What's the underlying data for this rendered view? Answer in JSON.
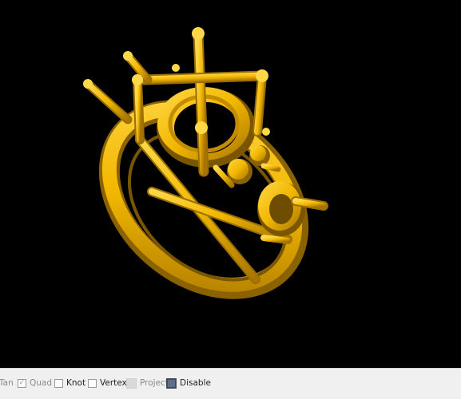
{
  "viewport": {
    "background": "#000000",
    "model_color": "#f2b800",
    "model_shadow": "#8a6200"
  },
  "status_bar": {
    "snaps": [
      {
        "label": "Tan",
        "checked": false,
        "enabled": false
      },
      {
        "label": "Quad",
        "checked": true,
        "enabled": false
      },
      {
        "label": "Knot",
        "checked": false,
        "enabled": true
      },
      {
        "label": "Vertex",
        "checked": false,
        "enabled": true
      },
      {
        "label": "Project",
        "checked": false,
        "enabled": false
      },
      {
        "label": "Disable",
        "checked": false,
        "enabled": true
      }
    ]
  }
}
